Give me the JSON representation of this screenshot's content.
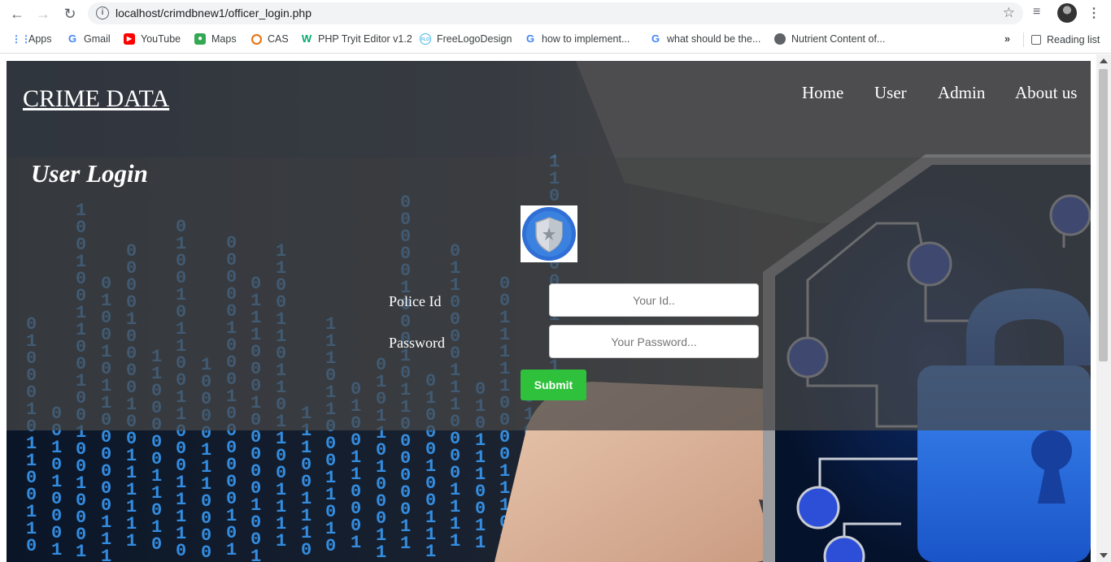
{
  "browser": {
    "url": "localhost/crimdbnew1/officer_login.php",
    "bookmarks": [
      {
        "label": "Apps",
        "icon": "apps-grid-icon"
      },
      {
        "label": "Gmail",
        "icon": "google-icon"
      },
      {
        "label": "YouTube",
        "icon": "youtube-icon"
      },
      {
        "label": "Maps",
        "icon": "maps-icon"
      },
      {
        "label": "CAS",
        "icon": "cas-icon"
      },
      {
        "label": "PHP Tryit Editor v1.2",
        "icon": "w3schools-icon"
      },
      {
        "label": "FreeLogoDesign",
        "icon": "flo-icon"
      },
      {
        "label": "how to implement...",
        "icon": "google-icon"
      },
      {
        "label": "what should be the...",
        "icon": "google-icon"
      },
      {
        "label": "Nutrient Content of...",
        "icon": "globe-icon"
      }
    ],
    "more": "»",
    "reading_list": "Reading list"
  },
  "site": {
    "title": "CRIME DATA",
    "nav": [
      "Home",
      "User",
      "Admin",
      "About us"
    ]
  },
  "login": {
    "heading": "User Login",
    "police_id_label": "Police Id",
    "police_id_placeholder": "Your Id..",
    "password_label": "Password",
    "password_placeholder": "Your Password...",
    "submit_label": "Submit"
  },
  "colors": {
    "submit": "#2fc13b",
    "binary": "#3aa0ff",
    "lock": "#2f6fe0"
  }
}
